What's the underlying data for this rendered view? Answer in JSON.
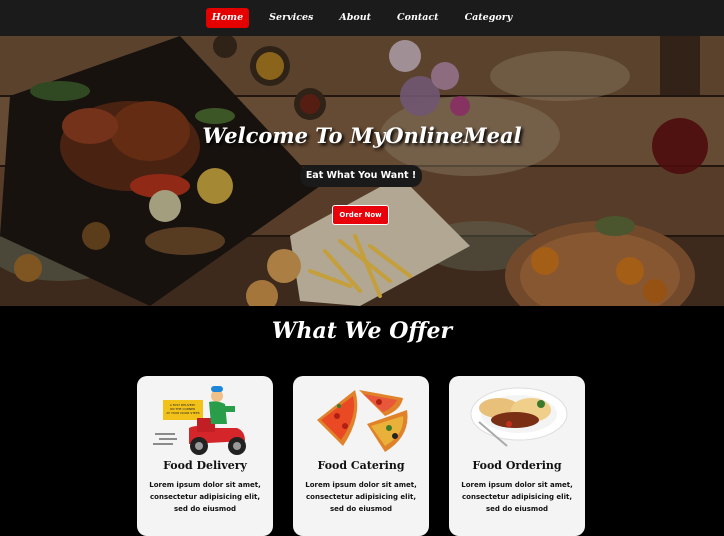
{
  "nav": {
    "items": [
      {
        "label": "Home",
        "active": true
      },
      {
        "label": "Services",
        "active": false
      },
      {
        "label": "About",
        "active": false
      },
      {
        "label": "Contact",
        "active": false
      },
      {
        "label": "Category",
        "active": false
      }
    ]
  },
  "hero": {
    "title": "Welcome To MyOnlineMeal",
    "tagline": "Eat What You Want !",
    "order_button": "Order Now"
  },
  "offer": {
    "title": "What We Offer",
    "cards": [
      {
        "title": "Food Delivery",
        "text": "Lorem ipsum dolor sit amet, consectetur adipisicing elit, sed do eiusmod",
        "sign_text": "A FAST DELIVERY ON THE CORNER AT YOUR DOOR STEPS"
      },
      {
        "title": "Food Catering",
        "text": "Lorem ipsum dolor sit amet, consectetur adipisicing elit, sed do eiusmod"
      },
      {
        "title": "Food Ordering",
        "text": "Lorem ipsum dolor sit amet, consectetur adipisicing elit, sed do eiusmod"
      }
    ]
  },
  "colors": {
    "accent": "#e50000",
    "navbar": "#1b1b1b",
    "page_bg": "#000000",
    "card_bg": "#f4f4f4"
  }
}
